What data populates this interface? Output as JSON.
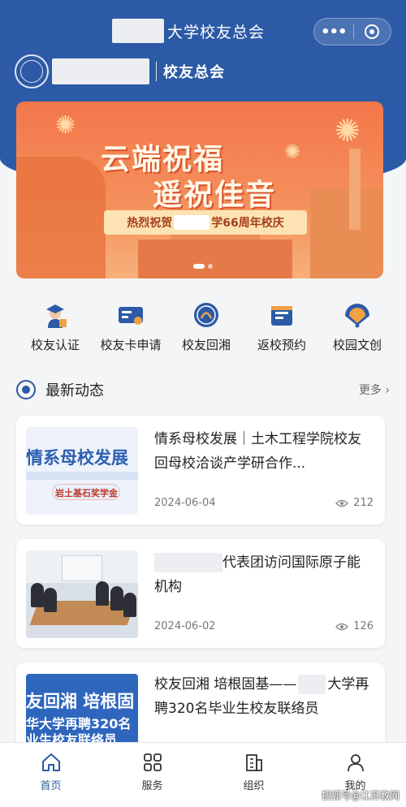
{
  "header": {
    "title": "大学校友总会",
    "menu_glyph": "•••",
    "logo_label": "校友总会"
  },
  "banner": {
    "line1": "云端祝福",
    "line2": "遥祝佳音",
    "ribbon_prefix": "热烈祝贺",
    "ribbon_suffix": "学66周年校庆"
  },
  "quick_actions": [
    {
      "label": "校友认证",
      "icon": "graduate-icon"
    },
    {
      "label": "校友卡申请",
      "icon": "card-icon"
    },
    {
      "label": "校友回湘",
      "icon": "emblem-icon"
    },
    {
      "label": "返校预约",
      "icon": "calendar-icon"
    },
    {
      "label": "校园文创",
      "icon": "fan-icon"
    }
  ],
  "section": {
    "title": "最新动态",
    "more": "更多 ›"
  },
  "news": [
    {
      "headline": "情系母校发展｜土木工程学院校友回母校洽谈产学研合作...",
      "date": "2024-06-04",
      "views": "212",
      "thumb_line1": "情系母校发展",
      "thumb_line2": "岩土基石奖学金"
    },
    {
      "headline_suffix": "代表团访问国际原子能机构",
      "date": "2024-06-02",
      "views": "126"
    },
    {
      "headline_a": "校友回湘 培根固基——",
      "headline_b": "大学再聘320名毕业生校友联络员",
      "thumb_line1": "友回湘 培根固",
      "thumb_line2": "华大学再聘320名",
      "thumb_line3": "业生校友联络员"
    }
  ],
  "tabbar": [
    {
      "label": "首页",
      "icon": "home-icon",
      "active": true
    },
    {
      "label": "服务",
      "icon": "grid-icon",
      "active": false
    },
    {
      "label": "组织",
      "icon": "building-icon",
      "active": false
    },
    {
      "label": "我的",
      "icon": "user-icon",
      "active": false
    }
  ],
  "watermark": "搜狐号@江苏教网",
  "colors": {
    "primary": "#2c5aa6",
    "banner": "#f3774a",
    "background": "#f4f5f7"
  }
}
